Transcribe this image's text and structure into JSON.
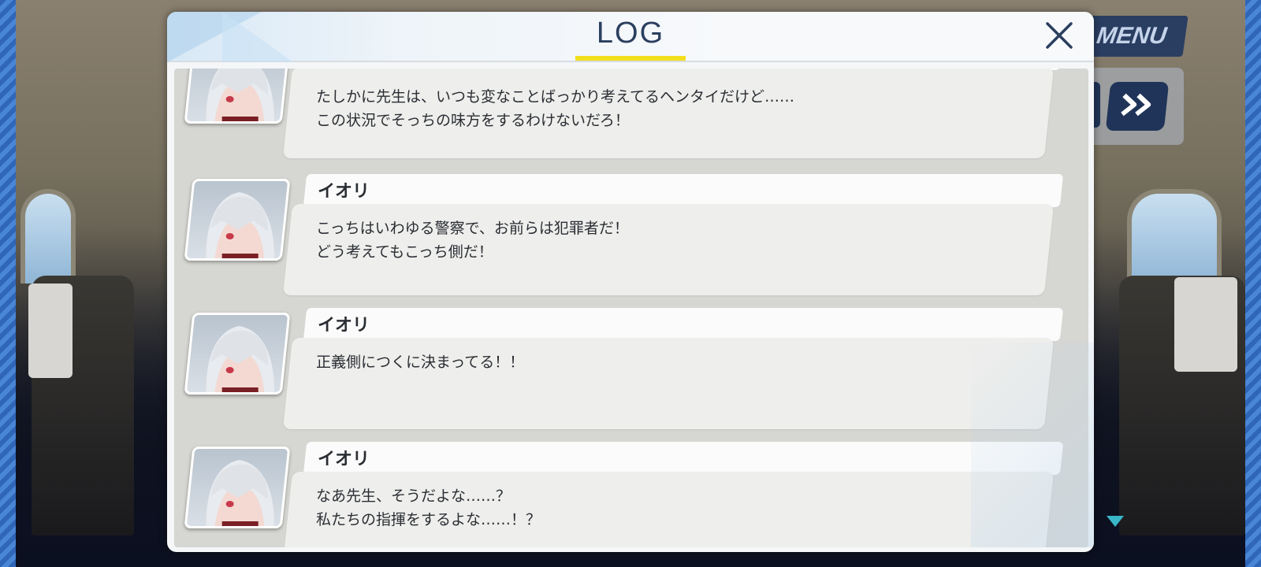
{
  "background": {
    "menu_label": "MENU",
    "skip_icon": "double-chevron-right-icon",
    "next_indicator_icon": "triangle-down-icon"
  },
  "log_panel": {
    "title": "LOG",
    "close_icon": "close-icon",
    "accent_color": "#f2df1c",
    "title_color": "#2b3f5f",
    "entries": [
      {
        "speaker": "",
        "avatar_icon": "character-portrait-icon",
        "lines": [
          "たしかに先生は、いつも変なことばっかり考えてるヘンタイだけど……",
          "この状況でそっちの味方をするわけないだろ！"
        ]
      },
      {
        "speaker": "イオリ",
        "avatar_icon": "character-portrait-icon",
        "lines": [
          "こっちはいわゆる警察で、お前らは犯罪者だ！",
          "どう考えてもこっち側だ！"
        ]
      },
      {
        "speaker": "イオリ",
        "avatar_icon": "character-portrait-icon",
        "lines": [
          "正義側につくに決まってる！！"
        ]
      },
      {
        "speaker": "イオリ",
        "avatar_icon": "character-portrait-icon",
        "lines": [
          "なあ先生、そうだよな……？",
          "私たちの指揮をするよな……！？"
        ]
      }
    ]
  }
}
